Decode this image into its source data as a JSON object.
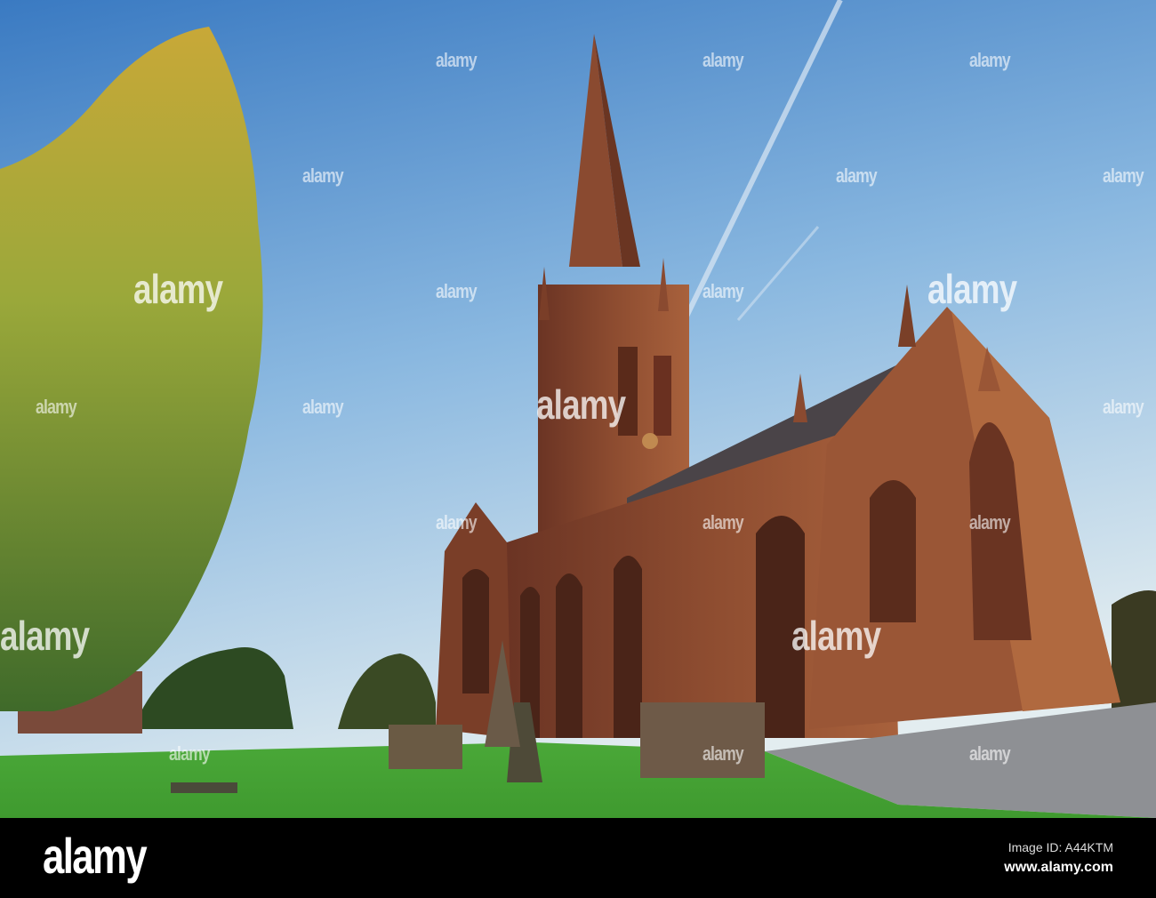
{
  "watermark": "alamy",
  "footer": {
    "logo": "alamy",
    "image_id": "Image ID: A44KTM",
    "website": "www.alamy.com"
  },
  "colors": {
    "sky_top": "#3f7fc4",
    "sky_bottom": "#dfeaf0",
    "stone": "#8a4a2e",
    "grass": "#4fb83a"
  }
}
